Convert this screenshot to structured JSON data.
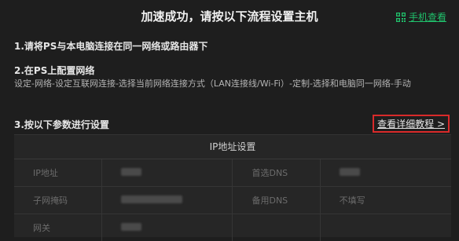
{
  "header": {
    "title": "加速成功，请按以下流程设置主机",
    "mobile_link_label": "手机查看",
    "mobile_link_color": "#20c06b"
  },
  "steps": [
    {
      "title": "1.请将PS与本电脑连接在同一网络或路由器下"
    },
    {
      "title": "2.在PS上配置网络",
      "desc": "设定-网络-设定互联网连接-选择当前网络连接方式（LAN连接线/Wi-Fi）-定制-选择和电脑同一网络-手动"
    },
    {
      "title": "3.按以下参数进行设置"
    }
  ],
  "detail_link": {
    "label": "查看详细教程 >",
    "highlight_color": "#d92a2a"
  },
  "ip_panel": {
    "title": "IP地址设置",
    "rows": [
      {
        "label1": "IP地址",
        "value1": "",
        "label2": "首选DNS",
        "value2": ""
      },
      {
        "label1": "子网掩码",
        "value1": "",
        "label2": "备用DNS",
        "value2": "不填写"
      },
      {
        "label1": "网关",
        "value1": "",
        "label2": "",
        "value2": ""
      }
    ]
  }
}
